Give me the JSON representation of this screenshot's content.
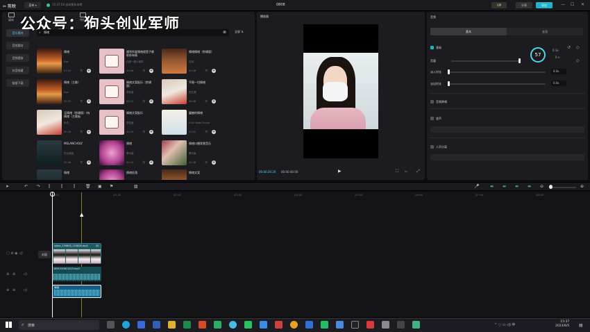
{
  "titlebar": {
    "logo": "✂ 剪映",
    "menu": "菜单 ▾",
    "status": "15:37:54 自动保存本地",
    "project": "0808",
    "vip": "VIP",
    "share": "分享",
    "export": "导出",
    "min": "—",
    "max": "☐",
    "close": "✕"
  },
  "watermark": "公众号：狗头创业军师",
  "toptabs": [
    {
      "label": "媒体"
    },
    {
      "label": "特效"
    }
  ],
  "sidebar": [
    {
      "label": "音乐素材",
      "active": true
    },
    {
      "label": "音效素材"
    },
    {
      "label": "音频提取"
    },
    {
      "label": "抖音收藏"
    },
    {
      "label": "链接下载"
    }
  ],
  "search": {
    "value": "情绪",
    "filter": "全部 ⇅"
  },
  "cards": [
    {
      "title": "情绪",
      "artist": "Eve",
      "dur": "01:10",
      "thumb": "sunset"
    },
    {
      "title": "遇到所爱情绪就是子都依依有情",
      "artist": "在那一箭小钢琴",
      "dur": "00:46",
      "thumb": "cake"
    },
    {
      "title": "情绪情绪（剪辑版）",
      "artist": "左耳",
      "dur": "00:28",
      "thumb": "brownsun"
    },
    {
      "title": "情绪（主歌）",
      "artist": "Eve",
      "dur": "00:33",
      "thumb": "sunset"
    },
    {
      "title": "情绪文案配乐（剪辑版）",
      "artist": "李若音",
      "dur": "00:22",
      "thumb": "cake"
    },
    {
      "title": "平稳一切情绪",
      "artist": "巴扎嘿",
      "dur": "00:48",
      "thumb": "cat"
    },
    {
      "title": "无情绪（剪辑版）(有情绪（主歌板",
      "artist": "乔杰",
      "dur": "00:26",
      "thumb": "cat"
    },
    {
      "title": "情绪文案配乐",
      "artist": "李若音",
      "dur": "00:29",
      "thumb": "cake"
    },
    {
      "title": "震撼的情绪",
      "artist": "Chill Mode Sound",
      "dur": "01:02",
      "thumb": "paris"
    },
    {
      "title": "MELANCHOLY",
      "artist": "巴比情绪",
      "dur": "00:46",
      "thumb": "dark"
    },
    {
      "title": "情绪",
      "artist": "萧可南",
      "dur": "00:15",
      "thumb": "pinkflower"
    },
    {
      "title": "情绪口播背景音乐",
      "artist": "萧可南",
      "dur": "02:38",
      "thumb": "flowers"
    },
    {
      "title": "情绪",
      "artist": "",
      "dur": "",
      "thumb": "dark"
    },
    {
      "title": "情绪低落",
      "artist": "",
      "dur": "",
      "thumb": "pinkflower"
    },
    {
      "title": "情绪文案",
      "artist": "",
      "dur": "",
      "thumb": "brownsun"
    }
  ],
  "preview": {
    "title": "播放器",
    "current": "00:00:26:26",
    "total": "00:00:46:00"
  },
  "inspector": {
    "title": "音频",
    "tab_basic": "基本",
    "tab_speed": "变速",
    "section_basic": "基础",
    "volume_label": "音量",
    "fadein_label": "淡入时长",
    "fadein_val": "0.0s",
    "fadeout_label": "淡出时长",
    "fadeout_val": "0.0s",
    "denoise": "音频降噪",
    "voice_change": "变声",
    "noise": "人声分离",
    "dial": "57",
    "dial_small": "0.3x",
    "dial_small2": "0 s"
  },
  "ruler": [
    "00:00",
    "|00:00",
    "|01:00",
    "|02:00",
    "|03:00",
    "|04:00",
    "|05:00",
    "|06:00",
    "|07:00",
    "|08:00"
  ],
  "tracks": {
    "video_label": "video_230805_153828.mp4",
    "video_dur": "00",
    "audio1_label": "1691220811023.mp3",
    "audio2_label": "情绪",
    "cover": "封面"
  },
  "taskbar": {
    "search": "搜索",
    "time": "15:37",
    "date": "2023/8/5"
  }
}
